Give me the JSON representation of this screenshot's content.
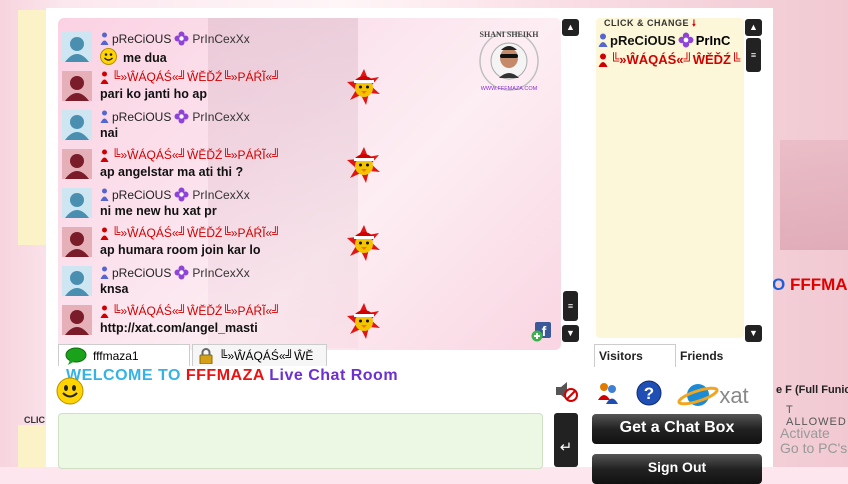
{
  "background": {
    "brand_text_left": "O",
    "brand_text_right": "FFFMA",
    "partial_text": "e F (Full Funic",
    "allowed_text": "T ALLOWED",
    "activate_line1": "Activate",
    "activate_line2": "Go to PC's",
    "click_text": "CLIC"
  },
  "logo": {
    "text_top": "SHANI SHEIKH",
    "text_bottom": "WWW.FFFMAZA.COM"
  },
  "messages": [
    {
      "user": "pReCiOUS",
      "tag": "PrInCexXx",
      "text": "me dua",
      "has_smiley": true,
      "color": "#222",
      "icon": "blue-person-icon",
      "santa": false
    },
    {
      "user": "╚»ŴÁQÁŚ«╝ŴĔĎŹ╚»PÁŔĨ«╝",
      "tag": "",
      "text": "pari ko janti ho ap",
      "has_smiley": false,
      "color": "#d10000",
      "icon": "red-person-icon",
      "santa": true
    },
    {
      "user": "pReCiOUS",
      "tag": "PrInCexXx",
      "text": "nai",
      "has_smiley": false,
      "color": "#222",
      "icon": "blue-person-icon",
      "santa": false
    },
    {
      "user": "╚»ŴÁQÁŚ«╝ŴĔĎŹ╚»PÁŔĨ«╝",
      "tag": "",
      "text": "ap angelstar ma ati thi ?",
      "has_smiley": false,
      "color": "#d10000",
      "icon": "red-person-icon",
      "santa": true
    },
    {
      "user": "pReCiOUS",
      "tag": "PrInCexXx",
      "text": "ni me new hu xat pr",
      "has_smiley": false,
      "color": "#222",
      "icon": "blue-person-icon",
      "santa": false
    },
    {
      "user": "╚»ŴÁQÁŚ«╝ŴĔĎŹ╚»PÁŔĨ«╝",
      "tag": "",
      "text": "ap humara room join kar lo",
      "has_smiley": false,
      "color": "#d10000",
      "icon": "red-person-icon",
      "santa": true
    },
    {
      "user": "pReCiOUS",
      "tag": "PrInCexXx",
      "text": "knsa",
      "has_smiley": false,
      "color": "#222",
      "icon": "blue-person-icon",
      "santa": false
    },
    {
      "user": "╚»ŴÁQÁŚ«╝ŴĔĎŹ╚»PÁŔĨ«╝",
      "tag": "",
      "text": "http://xat.com/angel_masti",
      "has_smiley": false,
      "color": "#d10000",
      "icon": "red-person-icon",
      "santa": true,
      "is_link": true
    }
  ],
  "userlist": {
    "header": "CLICK & CHANGE",
    "users": [
      {
        "name": "pReCiOUS",
        "tag": "PrInC",
        "color": "#111",
        "icon": "blue-person-icon"
      },
      {
        "name": "╚»ŴÁQÁŚ«╝ŴĔĎŹ╚",
        "tag": "",
        "color": "#d10000",
        "icon": "red-person-icon"
      }
    ]
  },
  "tabs": {
    "main": "fffmaza1",
    "pm": "╚»ŴÁQÁŚ«╝ŴĔ"
  },
  "side_tabs": {
    "visitors": "Visitors",
    "friends": "Friends"
  },
  "welcome": {
    "part1": "WELCOME TO",
    "part2": "FFFMAZA",
    "part3": "Live Chat Room"
  },
  "xat_label": "xat",
  "buttons": {
    "get_chat_box": "Get a Chat Box",
    "sign_out": "Sign Out"
  },
  "colors": {
    "accent_red": "#d10000",
    "button_dark": "#222222",
    "chat_pink": "#fbd2e3",
    "userlist_yellow": "#fbf7d8"
  }
}
